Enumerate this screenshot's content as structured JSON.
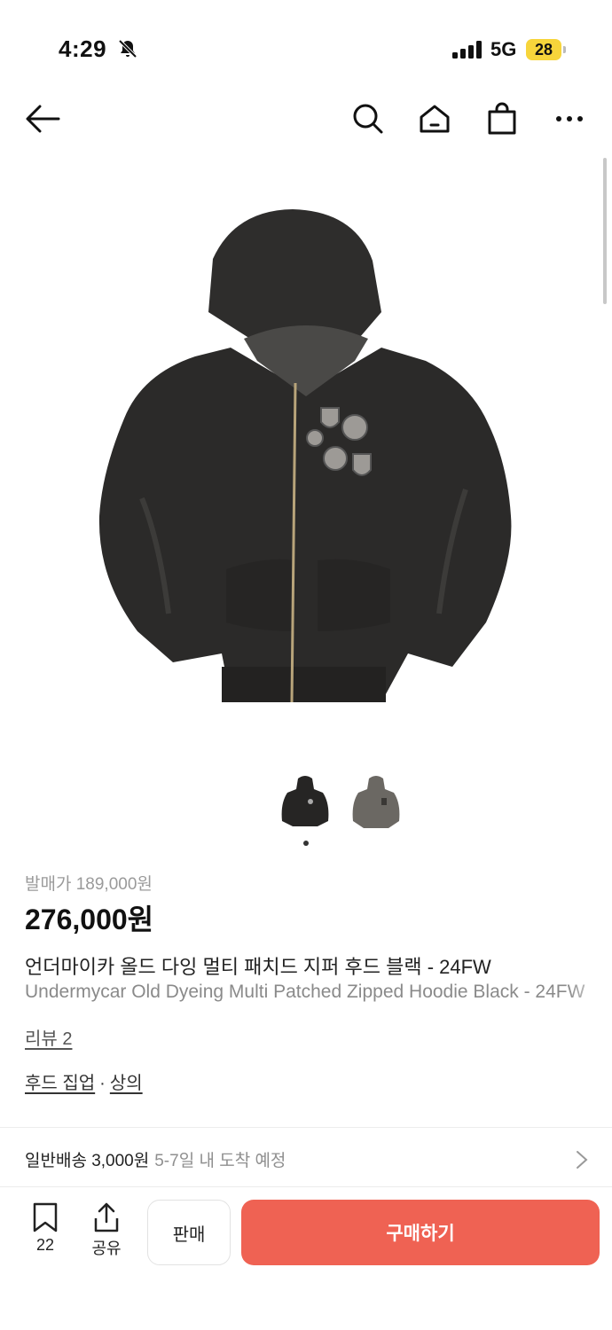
{
  "status": {
    "time": "4:29",
    "network": "5G",
    "battery": "28"
  },
  "nav": {
    "icons": [
      "back-arrow-icon",
      "search-icon",
      "home-icon",
      "shopping-bag-icon",
      "more-icon"
    ]
  },
  "product": {
    "release_price": "발매가 189,000원",
    "price": "276,000원",
    "title_ko": "언더마이카 올드 다잉 멀티 패치드 지퍼 후드 블랙 - 24FW",
    "title_en": "Undermycar Old Dyeing Multi Patched Zipped Hoodie Black - 24FW",
    "review": "리뷰 2",
    "category_1": "후드 집업",
    "category_sep": "·",
    "category_2": "상의"
  },
  "shipping": {
    "label": "일반배송 3,000원",
    "eta": "5-7일 내 도착 예정"
  },
  "bottom": {
    "save_count": "22",
    "share_label": "공유",
    "sell_label": "판매",
    "buy_label": "구매하기"
  },
  "colors": {
    "accent": "#ef6253",
    "battery": "#f7d53b"
  }
}
